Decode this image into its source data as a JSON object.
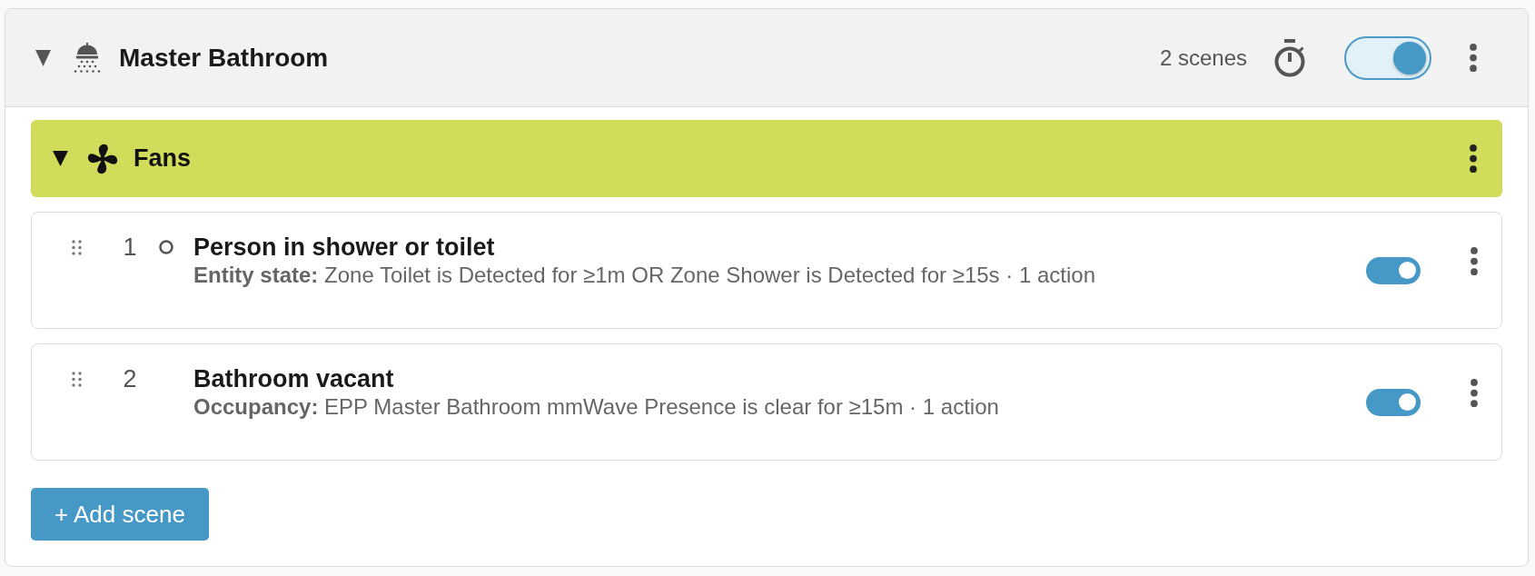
{
  "room": {
    "title": "Master Bathroom",
    "expanded": true,
    "scene_count": "2 scenes",
    "enabled": true
  },
  "group": {
    "title": "Fans",
    "expanded": true,
    "scenes": [
      {
        "number": "1",
        "marked": true,
        "title": "Person in shower or toilet",
        "condition": "**Entity state:** Zone Toilet is Detected for ≥1m OR Zone Shower is Detected for ≥15s · 1 action",
        "enabled": true
      },
      {
        "number": "2",
        "marked": false,
        "title": "Bathroom vacant",
        "condition": "**Occupancy:** EPP Master Bathroom mmWave Presence is clear for ≥15m · 1 action",
        "enabled": true
      }
    ]
  },
  "add_button": {
    "label": "+ Add scene"
  }
}
